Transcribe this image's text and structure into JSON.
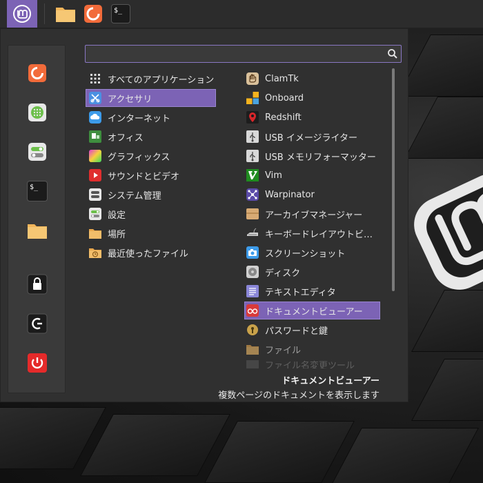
{
  "panel": {
    "launchers": [
      {
        "name": "Files",
        "icon": "folder-icon"
      },
      {
        "name": "Firefox",
        "icon": "firefox-icon"
      },
      {
        "name": "Terminal",
        "icon": "terminal-icon",
        "glyph": "$_"
      }
    ]
  },
  "sidebar": {
    "items": [
      {
        "icon": "firefox-icon"
      },
      {
        "icon": "software-manager-icon"
      },
      {
        "icon": "settings-toggle-icon"
      },
      {
        "icon": "terminal-icon",
        "glyph": "$_"
      },
      {
        "icon": "folder-icon"
      },
      {
        "icon": "lock-icon"
      },
      {
        "icon": "logout-icon"
      },
      {
        "icon": "power-icon"
      }
    ]
  },
  "search": {
    "value": "",
    "placeholder": ""
  },
  "categories": [
    {
      "label": "すべてのアプリケーション",
      "icon": "grid-icon"
    },
    {
      "label": "アクセサリ",
      "icon": "accessories-icon",
      "selected": true
    },
    {
      "label": "インターネット",
      "icon": "cloud-icon"
    },
    {
      "label": "オフィス",
      "icon": "office-icon"
    },
    {
      "label": "グラフィックス",
      "icon": "graphics-icon"
    },
    {
      "label": "サウンドとビデオ",
      "icon": "play-icon"
    },
    {
      "label": "システム管理",
      "icon": "system-icon"
    },
    {
      "label": "設定",
      "icon": "settings-icon"
    },
    {
      "label": "場所",
      "icon": "folder-icon"
    },
    {
      "label": "最近使ったファイル",
      "icon": "recent-folder-icon"
    }
  ],
  "apps": [
    {
      "label": "ClamTk",
      "icon": "clamtk-icon"
    },
    {
      "label": "Onboard",
      "icon": "onboard-icon"
    },
    {
      "label": "Redshift",
      "icon": "redshift-icon"
    },
    {
      "label": "USB イメージライター",
      "icon": "usb-icon"
    },
    {
      "label": "USB メモリフォーマッター",
      "icon": "usb-icon"
    },
    {
      "label": "Vim",
      "icon": "vim-icon"
    },
    {
      "label": "Warpinator",
      "icon": "warpinator-icon"
    },
    {
      "label": "アーカイブマネージャー",
      "icon": "archive-icon"
    },
    {
      "label": "キーボードレイアウトビ…",
      "icon": "keyboard-icon"
    },
    {
      "label": "スクリーンショット",
      "icon": "camera-icon"
    },
    {
      "label": "ディスク",
      "icon": "disk-icon"
    },
    {
      "label": "テキストエディタ",
      "icon": "text-editor-icon"
    },
    {
      "label": "ドキュメントビューアー",
      "icon": "document-viewer-icon",
      "selected": true
    },
    {
      "label": "パスワードと鍵",
      "icon": "password-icon"
    },
    {
      "label": "ファイル",
      "icon": "folder-icon"
    },
    {
      "label": "ファイル名変更ツール",
      "icon": "rename-icon"
    }
  ],
  "description": {
    "title": "ドキュメントビューアー",
    "text": "複数ページのドキュメントを表示します"
  },
  "colors": {
    "accent": "#7c63b5",
    "menu_bg": "#303030",
    "panel_bg": "#2c2c2c"
  }
}
